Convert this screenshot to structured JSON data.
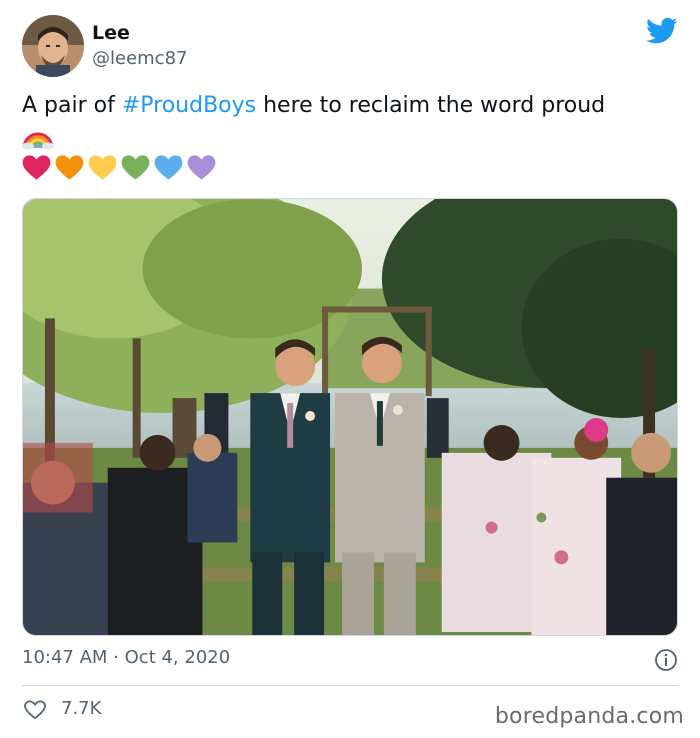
{
  "author": {
    "name": "Lee",
    "handle": "@leemc87"
  },
  "tweet": {
    "text_before": "A pair of ",
    "hashtag": "#ProudBoys",
    "text_after": " here to reclaim the word proud",
    "emoji_line_1": "rainbow",
    "hearts": [
      "#e0245e",
      "#f4900c",
      "#ffcc4d",
      "#78b159",
      "#5dadec",
      "#aa8ed6"
    ]
  },
  "meta": {
    "time": "10:47 AM",
    "separator": " · ",
    "date": "Oct 4, 2020"
  },
  "engagement": {
    "likes": "7.7K"
  },
  "watermark": "boredpanda.com",
  "colors": {
    "accent": "#1d9bf0",
    "muted": "#536471",
    "border": "#cfd9de"
  },
  "icons": {
    "brand": "twitter-bird-icon",
    "info": "info-icon",
    "like": "heart-outline-icon"
  }
}
